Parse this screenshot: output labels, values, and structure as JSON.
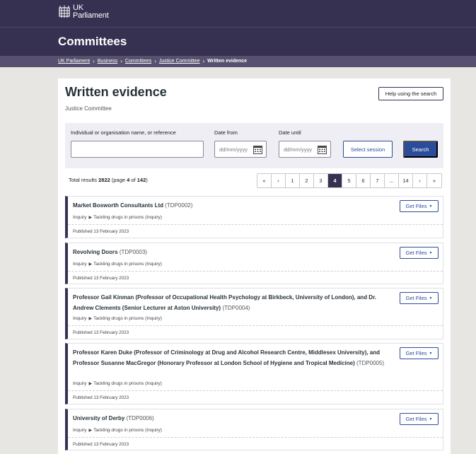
{
  "header": {
    "logo_line1": "UK",
    "logo_line2": "Parliament",
    "section_title": "Committees"
  },
  "breadcrumb": {
    "items": [
      "UK Parliament",
      "Business",
      "Committees",
      "Justice Committee"
    ],
    "current": "Written evidence"
  },
  "page": {
    "title": "Written evidence",
    "subtitle": "Justice Committee",
    "help_label": "Help using the search"
  },
  "filters": {
    "name_label": "Individual or organisation name, or reference",
    "name_value": "",
    "date_from_label": "Date from",
    "date_from_placeholder": "dd/mm/yyyy",
    "date_until_label": "Date until",
    "date_until_placeholder": "dd/mm/yyyy",
    "session_label": "Select session",
    "search_label": "Search"
  },
  "results": {
    "total_prefix": "Total results ",
    "total": "2822",
    "page_text_prefix": " (page ",
    "page": "4",
    "page_of": " of ",
    "pages": "142",
    "page_text_suffix": ")"
  },
  "pagination": [
    "«",
    "‹",
    "1",
    "2",
    "3",
    "4",
    "5",
    "6",
    "7",
    "...",
    "14",
    "›",
    "»"
  ],
  "pagination_active": "4",
  "cards": [
    {
      "name": "Market Bosworth Consultants Ltd",
      "ref": "(TDP0002)",
      "inquiry_label": "Inquiry",
      "inquiry": "Tackling drugs in prisons (Inquiry)",
      "published": "Published 13 February 2023",
      "button": "Get Files"
    },
    {
      "name": "Revolving Doors",
      "ref": "(TDP0003)",
      "inquiry_label": "Inquiry",
      "inquiry": "Tackling drugs in prisons (Inquiry)",
      "published": "Published 13 February 2023",
      "button": "Get Files"
    },
    {
      "name": "Professor Gail Kinman (Professor of Occupational Health Psychology at Birkbeck, University of London), and Dr. Andrew Clements (Senior Lecturer at Aston University)",
      "ref": "(TDP0004)",
      "inquiry_label": "Inquiry",
      "inquiry": "Tackling drugs in prisons (Inquiry)",
      "published": "Published 13 February 2023",
      "button": "Get Files"
    },
    {
      "name": "Professor Karen Duke (Professor of Criminology at Drug and Alcohol Research Centre, Middlesex University), and Professor Susanne MacGregor (Honorary Professor at London School of Hygiene and Tropical Medicine)",
      "ref": "(TDP0005)",
      "inquiry_label": "Inquiry",
      "inquiry": "Tackling drugs in prisons (Inquiry)",
      "published": "Published 13 February 2023",
      "button": "Get Files"
    },
    {
      "name": "University of Derby",
      "ref": "(TDP0006)",
      "inquiry_label": "Inquiry",
      "inquiry": "Tackling drugs in prisons (Inquiry)",
      "published": "Published 13 February 2023",
      "button": "Get Files"
    }
  ],
  "colors": {
    "brand": "#373151",
    "accent": "#2b4b9b",
    "background": "#e7e6e3"
  }
}
